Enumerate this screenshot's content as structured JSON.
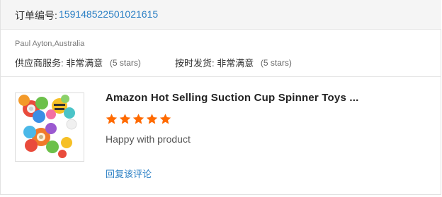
{
  "order": {
    "label": "订单编号:",
    "number": "15914852250102161​5"
  },
  "feedback": {
    "buyer": "Paul Ayton,Australia",
    "supplier_service_label": "供应商服务:",
    "supplier_service_value": "非常满意",
    "supplier_service_stars": "(5 stars)",
    "shipping_label": "按时发货:",
    "shipping_value": "非常满意",
    "shipping_stars": "(5 stars)"
  },
  "product": {
    "title": "Amazon Hot Selling Suction Cup Spinner Toys ...",
    "rating": 5,
    "rating_max": 5,
    "star_color": "#ff6a00",
    "comment": "Happy with product",
    "reply_link": "回复该评论"
  },
  "colors": {
    "link": "#2a7fc4",
    "header_bg": "#f5f5f5"
  }
}
